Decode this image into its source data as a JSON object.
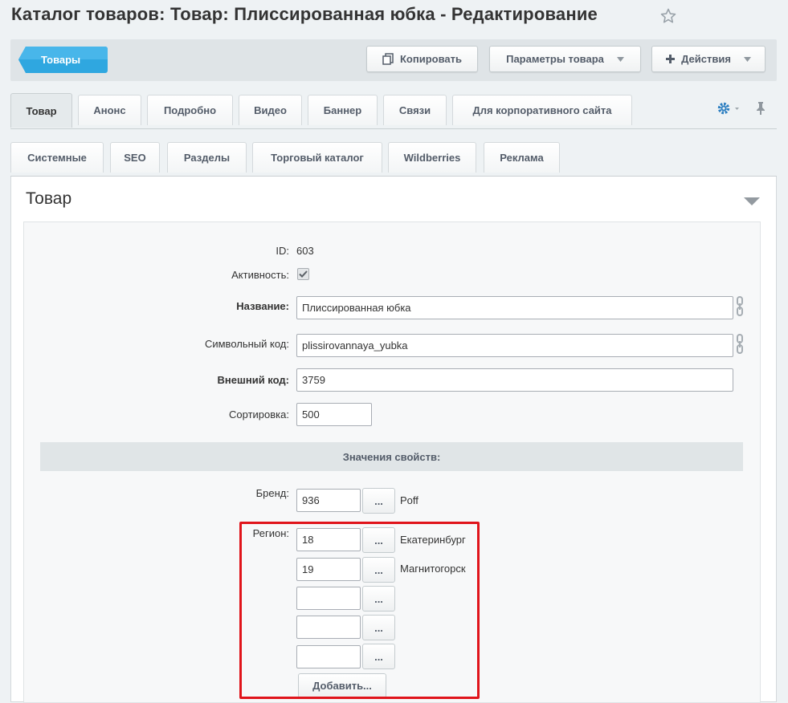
{
  "page_title": "Каталог товаров: Товар: Плиссированная юбка - Редактирование",
  "toolbar": {
    "back_label": "Товары",
    "copy_label": "Копировать",
    "params_label": "Параметры товара",
    "actions_label": "Действия"
  },
  "tabs_row1": [
    "Товар",
    "Анонс",
    "Подробно",
    "Видео",
    "Баннер",
    "Связи",
    "Для корпоративного сайта"
  ],
  "tabs_row2": [
    "Системные",
    "SEO",
    "Разделы",
    "Торговый каталог",
    "Wildberries",
    "Реклама"
  ],
  "section": {
    "title": "Товар"
  },
  "form": {
    "id_label": "ID:",
    "id_value": "603",
    "active_label": "Активность:",
    "active_checked": true,
    "name_label": "Название:",
    "name_value": "Плиссированная юбка",
    "code_label": "Символьный код:",
    "code_value": "plissirovannaya_yubka",
    "xml_label": "Внешний код:",
    "xml_value": "3759",
    "sort_label": "Сортировка:",
    "sort_value": "500",
    "props_header": "Значения свойств:",
    "brand_label": "Бренд:",
    "brand_value": "936",
    "brand_name": "Poff",
    "region_label": "Регион:",
    "regions": [
      {
        "value": "18",
        "name": "Екатеринбург"
      },
      {
        "value": "19",
        "name": "Магнитогорск"
      },
      {
        "value": "",
        "name": ""
      },
      {
        "value": "",
        "name": ""
      },
      {
        "value": "",
        "name": ""
      }
    ],
    "dots_label": "...",
    "add_label": "Добавить..."
  },
  "colors": {
    "accent_blue": "#2fa7e0",
    "highlight_red": "#e0141b",
    "gear_blue": "#2d7fc1"
  }
}
